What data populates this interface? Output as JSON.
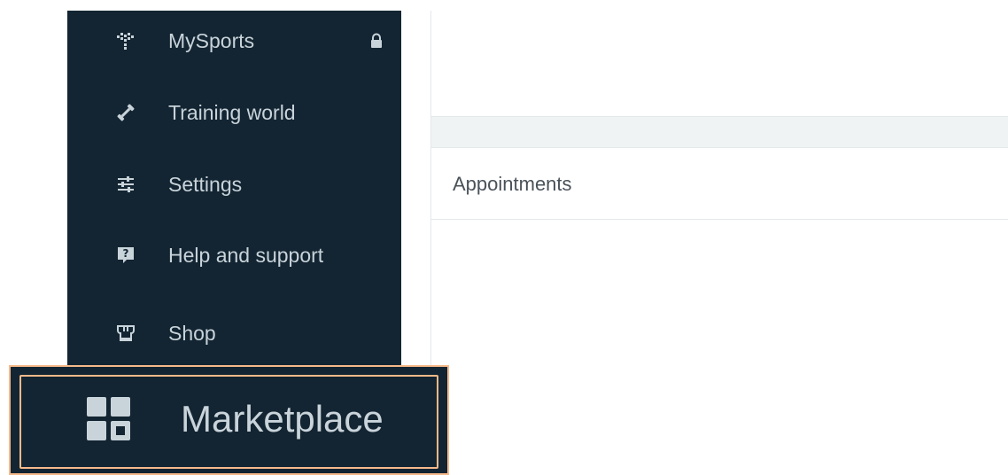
{
  "sidebar": {
    "items": [
      {
        "label": "MySports",
        "icon": "heartbeat-dots-icon",
        "locked": true
      },
      {
        "label": "Training world",
        "icon": "dumbbell-icon"
      },
      {
        "label": "Settings",
        "icon": "sliders-icon"
      },
      {
        "label": "Help and support",
        "icon": "help-question-icon"
      },
      {
        "label": "Shop",
        "icon": "shop-icon"
      }
    ],
    "highlighted_item": {
      "label": "Marketplace",
      "icon": "grid-apps-icon"
    }
  },
  "main": {
    "card": {
      "title": "Appointments"
    }
  },
  "colors": {
    "sidebar_bg": "#132532",
    "nav_text": "#c9d3da",
    "highlight_border": "#f6b98a"
  }
}
